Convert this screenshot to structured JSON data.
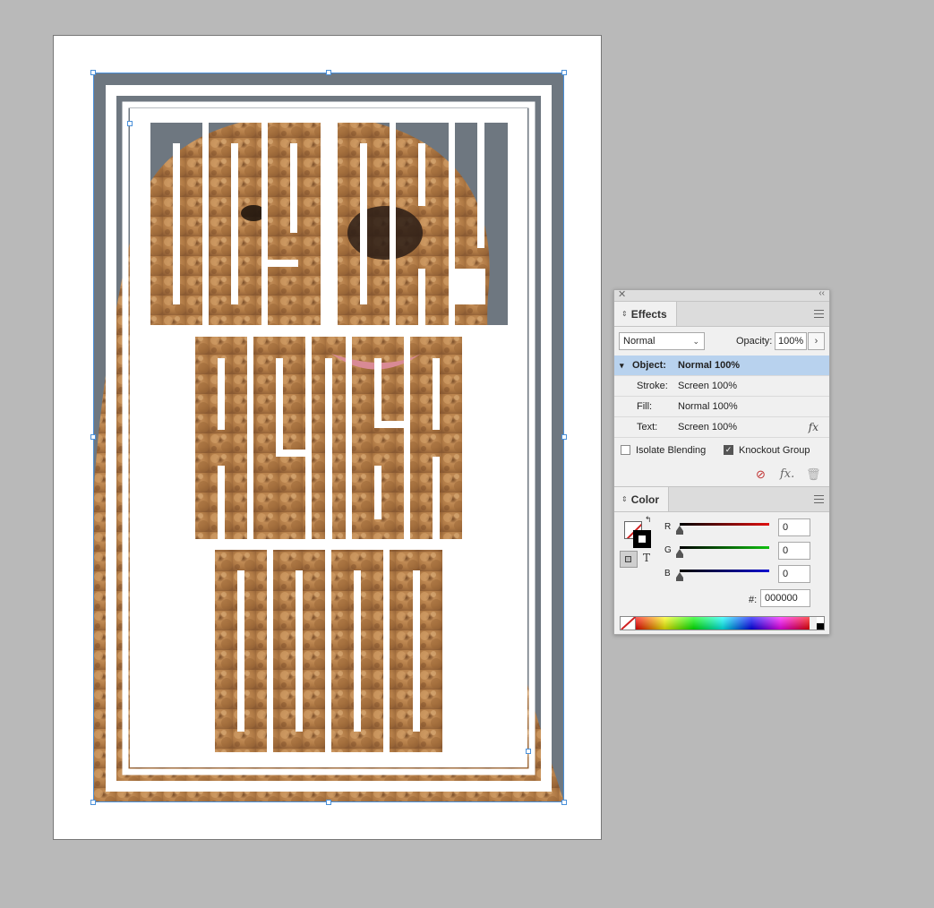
{
  "effects_panel": {
    "tab_label": "Effects",
    "blend_mode": "Normal",
    "opacity_label": "Opacity:",
    "opacity_value": "100%",
    "levels": [
      {
        "label": "Object:",
        "value": "Normal 100%"
      },
      {
        "label": "Stroke:",
        "value": "Screen 100%"
      },
      {
        "label": "Fill:",
        "value": "Normal 100%"
      },
      {
        "label": "Text:",
        "value": "Screen 100%"
      }
    ],
    "isolate_blending_label": "Isolate Blending",
    "isolate_blending_checked": false,
    "knockout_group_label": "Knockout Group",
    "knockout_group_checked": true
  },
  "color_panel": {
    "tab_label": "Color",
    "channels": [
      {
        "label": "R",
        "value": "0",
        "color": "#e01010"
      },
      {
        "label": "G",
        "value": "0",
        "color": "#10c010"
      },
      {
        "label": "B",
        "value": "0",
        "color": "#1010d0"
      }
    ],
    "hex_label": "#:",
    "hex_value": "000000",
    "format_text_glyph": "T"
  },
  "icons": {
    "close": "close-icon",
    "collapse": "collapse-icon",
    "fx": "fx-icon",
    "delete": "trash-icon",
    "clear_effects": "clear-effects-icon"
  },
  "colors": {
    "canvas_bg": "#b9b9b9",
    "selection": "#4a90d9",
    "frame_gray": "#6e7780",
    "dog_tan": "#c08a52"
  }
}
